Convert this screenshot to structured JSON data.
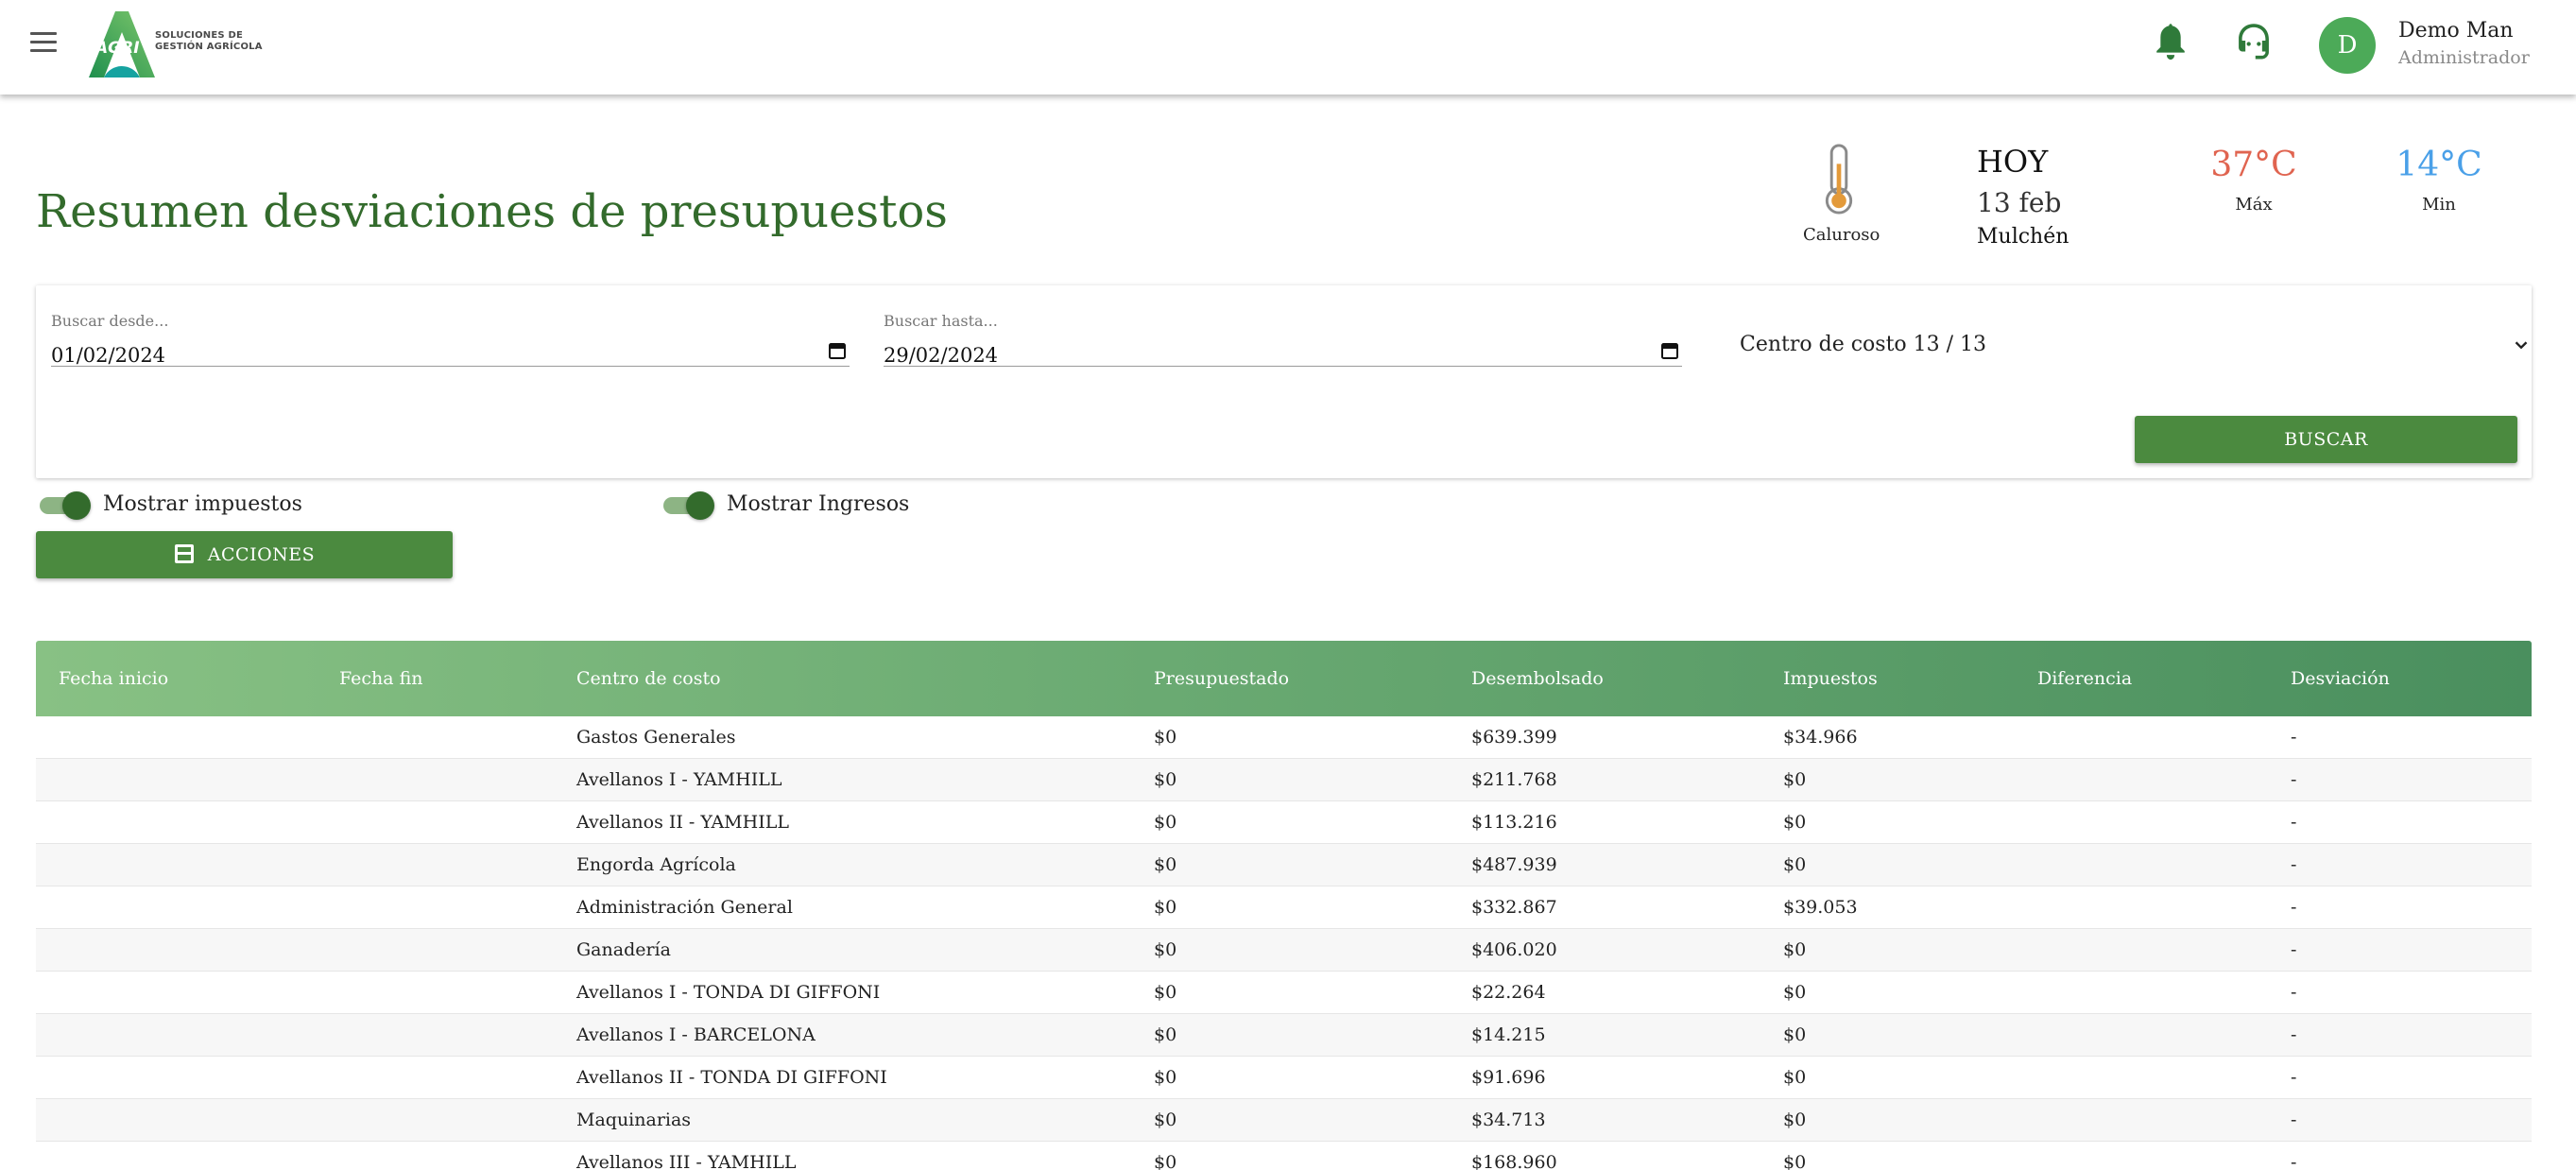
{
  "header": {
    "logo_brand": "AGRI",
    "logo_line1": "SOLUCIONES DE",
    "logo_line2": "GESTIÓN AGRÍCOLA",
    "avatar_initial": "D",
    "user_name": "Demo Man",
    "user_role": "Administrador"
  },
  "page": {
    "title": "Resumen desviaciones de presupuestos"
  },
  "weather": {
    "condition": "Caluroso",
    "today": "HOY",
    "date": "13 feb",
    "city": "Mulchén",
    "max_temp": "37°C",
    "max_label": "Máx",
    "min_temp": "14°C",
    "min_label": "Min"
  },
  "filters": {
    "from_label": "Buscar desde...",
    "from_value": "01/02/2024",
    "to_label": "Buscar hasta...",
    "to_value": "29/02/2024",
    "cost_center": "Centro de costo 13 / 13",
    "search_button": "BUSCAR"
  },
  "toggles": {
    "taxes_label": "Mostrar impuestos",
    "income_label": "Mostrar Ingresos"
  },
  "actions_button": "ACCIONES",
  "table": {
    "headers": [
      "Fecha inicio",
      "Fecha fin",
      "Centro de costo",
      "Presupuestado",
      "Desembolsado",
      "Impuestos",
      "Diferencia",
      "Desviación"
    ],
    "rows": [
      [
        "",
        "",
        "Gastos Generales",
        "$0",
        "$639.399",
        "$34.966",
        "",
        "-"
      ],
      [
        "",
        "",
        "Avellanos I - YAMHILL",
        "$0",
        "$211.768",
        "$0",
        "",
        "-"
      ],
      [
        "",
        "",
        "Avellanos II - YAMHILL",
        "$0",
        "$113.216",
        "$0",
        "",
        "-"
      ],
      [
        "",
        "",
        "Engorda Agrícola",
        "$0",
        "$487.939",
        "$0",
        "",
        "-"
      ],
      [
        "",
        "",
        "Administración General",
        "$0",
        "$332.867",
        "$39.053",
        "",
        "-"
      ],
      [
        "",
        "",
        "Ganadería",
        "$0",
        "$406.020",
        "$0",
        "",
        "-"
      ],
      [
        "",
        "",
        "Avellanos I - TONDA DI GIFFONI",
        "$0",
        "$22.264",
        "$0",
        "",
        "-"
      ],
      [
        "",
        "",
        "Avellanos I - BARCELONA",
        "$0",
        "$14.215",
        "$0",
        "",
        "-"
      ],
      [
        "",
        "",
        "Avellanos II - TONDA DI GIFFONI",
        "$0",
        "$91.696",
        "$0",
        "",
        "-"
      ],
      [
        "",
        "",
        "Maquinarias",
        "$0",
        "$34.713",
        "$0",
        "",
        "-"
      ],
      [
        "",
        "",
        "Avellanos III - YAMHILL",
        "$0",
        "$168.960",
        "$0",
        "",
        "-"
      ]
    ]
  },
  "colors": {
    "brand_green": "#336b2c",
    "button_green": "#4b8a3f",
    "max_temp": "#e06450",
    "min_temp": "#4aa0e8"
  },
  "icons": [
    "menu-icon",
    "bell-icon",
    "headset-icon",
    "thermometer-icon",
    "calendar-icon",
    "chevron-down-icon",
    "inbox-icon"
  ]
}
